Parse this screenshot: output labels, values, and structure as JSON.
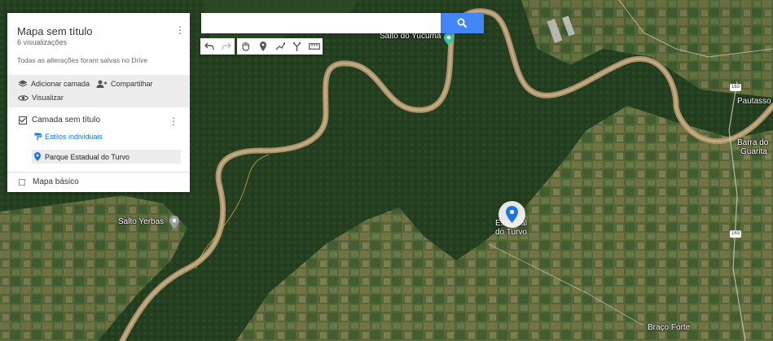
{
  "map": {
    "labels": {
      "salto_yucuma": "Salto do Yucumã",
      "salto_yerbas": "Salto Yerbas",
      "estadual_line1": "Estadual",
      "estadual_line2": "do Turvo",
      "barra_guarita_1": "Barra do",
      "barra_guarita_2": "Guarita",
      "braco_forte": "Braço Forte",
      "pauta": "Pautasso",
      "route_163": "163"
    },
    "colors": {
      "forest": "#24401f",
      "fields": "#5d7040",
      "river": "#b49b72",
      "marker": "#1a73e8"
    }
  },
  "panel": {
    "title": "Mapa sem título",
    "views": "6 visualizações",
    "saved_status": "Todas as alterações foram salvas no Drive",
    "actions": {
      "add_layer": "Adicionar camada",
      "share": "Compartilhar",
      "preview": "Visualizar"
    },
    "layer": {
      "name": "Camada sem título",
      "styles_link": "Estilos individuais",
      "places": [
        {
          "name": "Parque Estadual do Turvo"
        }
      ]
    },
    "basemap": "Mapa básico"
  },
  "search": {
    "value": "",
    "placeholder": ""
  },
  "toolbar": {
    "icons": [
      "undo-icon",
      "redo-icon",
      "hand-icon",
      "marker-icon",
      "draw-line-icon",
      "directions-icon",
      "ruler-icon"
    ]
  }
}
